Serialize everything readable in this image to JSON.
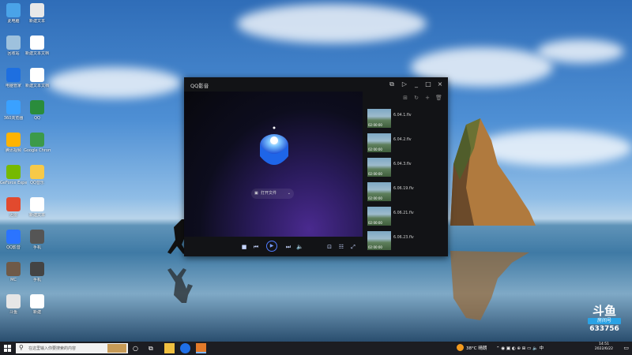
{
  "desktop": {
    "icons": [
      {
        "label": "此电脑",
        "color": "#4aa3e8"
      },
      {
        "label": "新建文本",
        "color": "#e8e8e8"
      },
      {
        "label": "回收站",
        "color": "#9ec1dd"
      },
      {
        "label": "新建文本文档",
        "color": "#ffffff"
      },
      {
        "label": "电脑管家",
        "color": "#1e6fe0"
      },
      {
        "label": "新建文本文档",
        "color": "#ffffff"
      },
      {
        "label": "360浏览器",
        "color": "#3aa1ff"
      },
      {
        "label": "QQ",
        "color": "#2a8c3c"
      },
      {
        "label": "腾讯视频",
        "color": "#ffb300"
      },
      {
        "label": "Google Chrome",
        "color": "#3c9a4a"
      },
      {
        "label": "GeForce Experience",
        "color": "#76b900"
      },
      {
        "label": "QQ音乐",
        "color": "#f7c948"
      },
      {
        "label": "迅雷",
        "color": "#e24a2e"
      },
      {
        "label": "新建文本",
        "color": "#ffffff"
      },
      {
        "label": "QQ影音",
        "color": "#2b74ff"
      },
      {
        "label": "手机",
        "color": "#555555"
      },
      {
        "label": "MC",
        "color": "#6f5a48"
      },
      {
        "label": "手机",
        "color": "#444444"
      },
      {
        "label": "斗鱼",
        "color": "#e6e6e6"
      },
      {
        "label": "新建",
        "color": "#ffffff"
      }
    ]
  },
  "player": {
    "app_title": "QQ影音",
    "window_buttons": {
      "minimize": "_",
      "maximize": "□",
      "close": "×"
    },
    "open_file_label": "打开文件",
    "playlist": [
      {
        "name": "6.04.1.flv",
        "duration": "02:00:00"
      },
      {
        "name": "6.04.2.flv",
        "duration": "02:00:00"
      },
      {
        "name": "6.04.3.flv",
        "duration": "02:00:00"
      },
      {
        "name": "6.06.19.flv",
        "duration": "02:00:00"
      },
      {
        "name": "6.06.21.flv",
        "duration": "02:00:00"
      },
      {
        "name": "6.06.23.flv",
        "duration": "02:00:00"
      }
    ]
  },
  "taskbar": {
    "search_placeholder": "在这里输入你要搜索的内容",
    "weather": "38°C 晴朗",
    "time": "14:51",
    "date": "2022/6/22"
  },
  "watermark": {
    "logo": "斗鱼",
    "room_label": "房间号",
    "room_number": "633756"
  }
}
